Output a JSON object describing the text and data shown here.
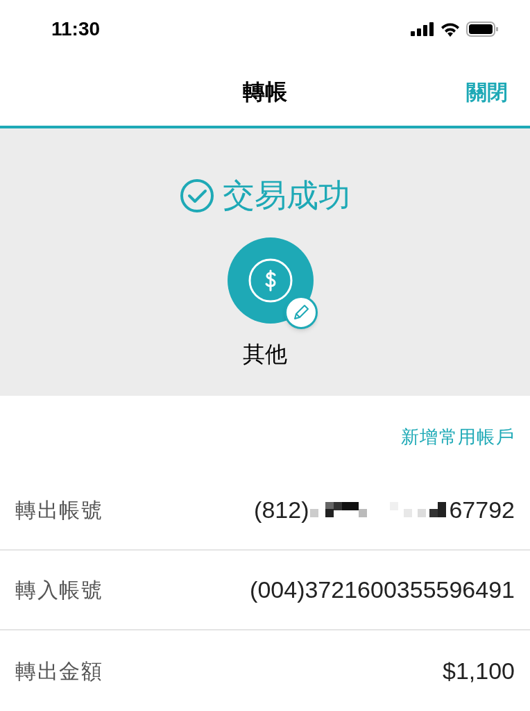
{
  "status_bar": {
    "time": "11:30"
  },
  "header": {
    "title": "轉帳",
    "close": "關閉"
  },
  "result": {
    "message": "交易成功",
    "category": "其他"
  },
  "add_favorite": "新增常用帳戶",
  "details": [
    {
      "kind": "redacted",
      "label": "轉出帳號",
      "prefix": "(812)",
      "suffix": "67792"
    },
    {
      "kind": "plain",
      "label": "轉入帳號",
      "value": "(004)3721600355596491"
    },
    {
      "kind": "plain",
      "label": "轉出金額",
      "value": "$1,100"
    }
  ]
}
